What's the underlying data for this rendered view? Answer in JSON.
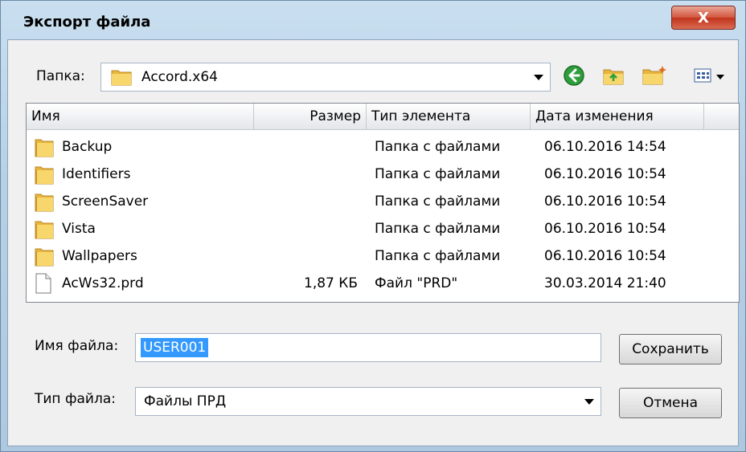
{
  "window": {
    "title": "Экспорт файла",
    "close_glyph": "X"
  },
  "toolbar": {
    "folder_label": "Папка:",
    "folder_value": "Accord.x64",
    "icons": [
      "back-icon",
      "up-folder-icon",
      "new-folder-icon",
      "view-menu-icon"
    ]
  },
  "list": {
    "columns": [
      "Имя",
      "Размер",
      "Тип элемента",
      "Дата изменения"
    ],
    "rows": [
      {
        "name": "Backup",
        "size": "",
        "type": "Папка с файлами",
        "date": "06.10.2016 14:54",
        "icon": "folder"
      },
      {
        "name": "Identifiers",
        "size": "",
        "type": "Папка с файлами",
        "date": "06.10.2016 10:54",
        "icon": "folder"
      },
      {
        "name": "ScreenSaver",
        "size": "",
        "type": "Папка с файлами",
        "date": "06.10.2016 10:54",
        "icon": "folder"
      },
      {
        "name": "Vista",
        "size": "",
        "type": "Папка с файлами",
        "date": "06.10.2016 10:54",
        "icon": "folder"
      },
      {
        "name": "Wallpapers",
        "size": "",
        "type": "Папка с файлами",
        "date": "06.10.2016 10:54",
        "icon": "folder"
      },
      {
        "name": "AcWs32.prd",
        "size": "1,87 КБ",
        "type": "Файл \"PRD\"",
        "date": "30.03.2014 21:40",
        "icon": "file"
      }
    ]
  },
  "form": {
    "filename_label": "Имя файла:",
    "filename_value": "USER001",
    "filetype_label": "Тип файла:",
    "filetype_value": "Файлы ПРД",
    "save_label": "Сохранить",
    "cancel_label": "Отмена"
  },
  "colors": {
    "selection": "#3399ff",
    "folder": "#f2c94c",
    "close": "#c2331b"
  }
}
